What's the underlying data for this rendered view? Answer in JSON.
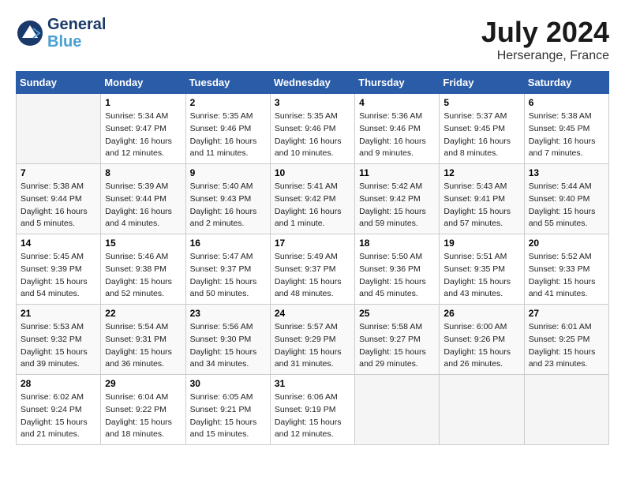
{
  "logo": {
    "line1": "General",
    "line2": "Blue",
    "tagline": ""
  },
  "title": {
    "month_year": "July 2024",
    "location": "Herserange, France"
  },
  "days_of_week": [
    "Sunday",
    "Monday",
    "Tuesday",
    "Wednesday",
    "Thursday",
    "Friday",
    "Saturday"
  ],
  "weeks": [
    [
      {
        "day": "",
        "sunrise": "",
        "sunset": "",
        "daylight": "",
        "empty": true
      },
      {
        "day": "1",
        "sunrise": "Sunrise: 5:34 AM",
        "sunset": "Sunset: 9:47 PM",
        "daylight": "Daylight: 16 hours and 12 minutes."
      },
      {
        "day": "2",
        "sunrise": "Sunrise: 5:35 AM",
        "sunset": "Sunset: 9:46 PM",
        "daylight": "Daylight: 16 hours and 11 minutes."
      },
      {
        "day": "3",
        "sunrise": "Sunrise: 5:35 AM",
        "sunset": "Sunset: 9:46 PM",
        "daylight": "Daylight: 16 hours and 10 minutes."
      },
      {
        "day": "4",
        "sunrise": "Sunrise: 5:36 AM",
        "sunset": "Sunset: 9:46 PM",
        "daylight": "Daylight: 16 hours and 9 minutes."
      },
      {
        "day": "5",
        "sunrise": "Sunrise: 5:37 AM",
        "sunset": "Sunset: 9:45 PM",
        "daylight": "Daylight: 16 hours and 8 minutes."
      },
      {
        "day": "6",
        "sunrise": "Sunrise: 5:38 AM",
        "sunset": "Sunset: 9:45 PM",
        "daylight": "Daylight: 16 hours and 7 minutes."
      }
    ],
    [
      {
        "day": "7",
        "sunrise": "Sunrise: 5:38 AM",
        "sunset": "Sunset: 9:44 PM",
        "daylight": "Daylight: 16 hours and 5 minutes."
      },
      {
        "day": "8",
        "sunrise": "Sunrise: 5:39 AM",
        "sunset": "Sunset: 9:44 PM",
        "daylight": "Daylight: 16 hours and 4 minutes."
      },
      {
        "day": "9",
        "sunrise": "Sunrise: 5:40 AM",
        "sunset": "Sunset: 9:43 PM",
        "daylight": "Daylight: 16 hours and 2 minutes."
      },
      {
        "day": "10",
        "sunrise": "Sunrise: 5:41 AM",
        "sunset": "Sunset: 9:42 PM",
        "daylight": "Daylight: 16 hours and 1 minute."
      },
      {
        "day": "11",
        "sunrise": "Sunrise: 5:42 AM",
        "sunset": "Sunset: 9:42 PM",
        "daylight": "Daylight: 15 hours and 59 minutes."
      },
      {
        "day": "12",
        "sunrise": "Sunrise: 5:43 AM",
        "sunset": "Sunset: 9:41 PM",
        "daylight": "Daylight: 15 hours and 57 minutes."
      },
      {
        "day": "13",
        "sunrise": "Sunrise: 5:44 AM",
        "sunset": "Sunset: 9:40 PM",
        "daylight": "Daylight: 15 hours and 55 minutes."
      }
    ],
    [
      {
        "day": "14",
        "sunrise": "Sunrise: 5:45 AM",
        "sunset": "Sunset: 9:39 PM",
        "daylight": "Daylight: 15 hours and 54 minutes."
      },
      {
        "day": "15",
        "sunrise": "Sunrise: 5:46 AM",
        "sunset": "Sunset: 9:38 PM",
        "daylight": "Daylight: 15 hours and 52 minutes."
      },
      {
        "day": "16",
        "sunrise": "Sunrise: 5:47 AM",
        "sunset": "Sunset: 9:37 PM",
        "daylight": "Daylight: 15 hours and 50 minutes."
      },
      {
        "day": "17",
        "sunrise": "Sunrise: 5:49 AM",
        "sunset": "Sunset: 9:37 PM",
        "daylight": "Daylight: 15 hours and 48 minutes."
      },
      {
        "day": "18",
        "sunrise": "Sunrise: 5:50 AM",
        "sunset": "Sunset: 9:36 PM",
        "daylight": "Daylight: 15 hours and 45 minutes."
      },
      {
        "day": "19",
        "sunrise": "Sunrise: 5:51 AM",
        "sunset": "Sunset: 9:35 PM",
        "daylight": "Daylight: 15 hours and 43 minutes."
      },
      {
        "day": "20",
        "sunrise": "Sunrise: 5:52 AM",
        "sunset": "Sunset: 9:33 PM",
        "daylight": "Daylight: 15 hours and 41 minutes."
      }
    ],
    [
      {
        "day": "21",
        "sunrise": "Sunrise: 5:53 AM",
        "sunset": "Sunset: 9:32 PM",
        "daylight": "Daylight: 15 hours and 39 minutes."
      },
      {
        "day": "22",
        "sunrise": "Sunrise: 5:54 AM",
        "sunset": "Sunset: 9:31 PM",
        "daylight": "Daylight: 15 hours and 36 minutes."
      },
      {
        "day": "23",
        "sunrise": "Sunrise: 5:56 AM",
        "sunset": "Sunset: 9:30 PM",
        "daylight": "Daylight: 15 hours and 34 minutes."
      },
      {
        "day": "24",
        "sunrise": "Sunrise: 5:57 AM",
        "sunset": "Sunset: 9:29 PM",
        "daylight": "Daylight: 15 hours and 31 minutes."
      },
      {
        "day": "25",
        "sunrise": "Sunrise: 5:58 AM",
        "sunset": "Sunset: 9:27 PM",
        "daylight": "Daylight: 15 hours and 29 minutes."
      },
      {
        "day": "26",
        "sunrise": "Sunrise: 6:00 AM",
        "sunset": "Sunset: 9:26 PM",
        "daylight": "Daylight: 15 hours and 26 minutes."
      },
      {
        "day": "27",
        "sunrise": "Sunrise: 6:01 AM",
        "sunset": "Sunset: 9:25 PM",
        "daylight": "Daylight: 15 hours and 23 minutes."
      }
    ],
    [
      {
        "day": "28",
        "sunrise": "Sunrise: 6:02 AM",
        "sunset": "Sunset: 9:24 PM",
        "daylight": "Daylight: 15 hours and 21 minutes."
      },
      {
        "day": "29",
        "sunrise": "Sunrise: 6:04 AM",
        "sunset": "Sunset: 9:22 PM",
        "daylight": "Daylight: 15 hours and 18 minutes."
      },
      {
        "day": "30",
        "sunrise": "Sunrise: 6:05 AM",
        "sunset": "Sunset: 9:21 PM",
        "daylight": "Daylight: 15 hours and 15 minutes."
      },
      {
        "day": "31",
        "sunrise": "Sunrise: 6:06 AM",
        "sunset": "Sunset: 9:19 PM",
        "daylight": "Daylight: 15 hours and 12 minutes."
      },
      {
        "day": "",
        "sunrise": "",
        "sunset": "",
        "daylight": "",
        "empty": true
      },
      {
        "day": "",
        "sunrise": "",
        "sunset": "",
        "daylight": "",
        "empty": true
      },
      {
        "day": "",
        "sunrise": "",
        "sunset": "",
        "daylight": "",
        "empty": true
      }
    ]
  ]
}
